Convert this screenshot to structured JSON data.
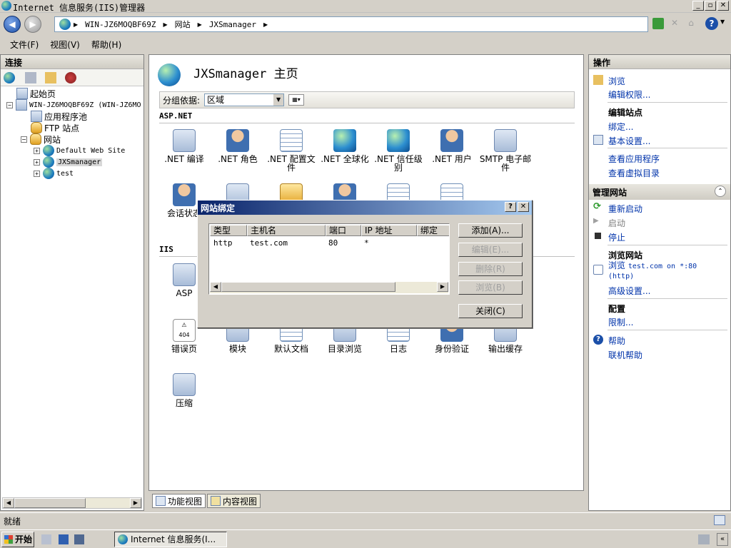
{
  "window": {
    "title": "Internet 信息服务(IIS)管理器"
  },
  "address": {
    "crumbs": [
      "WIN-JZ6MOQBF69Z",
      "网站",
      "JXSmanager"
    ]
  },
  "menu": [
    "文件(F)",
    "视图(V)",
    "帮助(H)"
  ],
  "left": {
    "header": "连接",
    "tree": [
      {
        "label": "起始页"
      },
      {
        "label": "WIN-JZ6MOQBF69Z (WIN-JZ6MO"
      },
      {
        "label": "应用程序池"
      },
      {
        "label": "FTP 站点"
      },
      {
        "label": "网站"
      },
      {
        "label": "Default Web Site"
      },
      {
        "label": "JXSmanager"
      },
      {
        "label": "test"
      }
    ]
  },
  "center": {
    "title": "JXSmanager 主页",
    "group_label": "分组依据:",
    "group_value": "区域",
    "aspnet_header": "ASP.NET",
    "iis_header": "IIS",
    "features_row1": [
      ".NET 编译",
      ".NET 角色",
      ".NET 配置文件",
      ".NET 全球化",
      ".NET 信任级别",
      ".NET 用户",
      "SMTP 电子邮件"
    ],
    "feature_row2_first": "会话状态",
    "feature_asp": "ASP",
    "features_row4": [
      "错误页",
      "模块",
      "默认文档",
      "目录浏览",
      "日志",
      "身份验证",
      "输出缓存"
    ],
    "feature_compress": "压缩",
    "tabs": {
      "features": "功能视图",
      "content": "内容视图"
    }
  },
  "dialog": {
    "title": "网站绑定",
    "help": "?",
    "columns": [
      "类型",
      "主机名",
      "端口",
      "IP 地址",
      "绑定"
    ],
    "rows": [
      {
        "type": "http",
        "host": "test.com",
        "port": "80",
        "ip": "*"
      }
    ],
    "buttons": {
      "add": "添加(A)...",
      "edit": "编辑(E)...",
      "remove": "删除(R)",
      "browse": "浏览(B)",
      "close": "关闭(C)"
    }
  },
  "right": {
    "header": "操作",
    "browse": "浏览",
    "edit_perms": "编辑权限...",
    "edit_site_head": "编辑站点",
    "bindings": "绑定...",
    "basic_settings": "基本设置...",
    "view_apps": "查看应用程序",
    "view_vdirs": "查看虚拟目录",
    "manage_head": "管理网站",
    "restart": "重新启动",
    "start": "启动",
    "stop": "停止",
    "browse_site_head": "浏览网站",
    "browse_site_pre": "浏览",
    "browse_site_target": "test.com on *:80",
    "browse_site_proto": "(http)",
    "advanced": "高级设置...",
    "config_head": "配置",
    "limits": "限制...",
    "help": "帮助",
    "online_help": "联机帮助"
  },
  "status": {
    "text": "就绪"
  },
  "taskbar": {
    "start": "开始",
    "item": "Internet 信息服务(I..."
  }
}
